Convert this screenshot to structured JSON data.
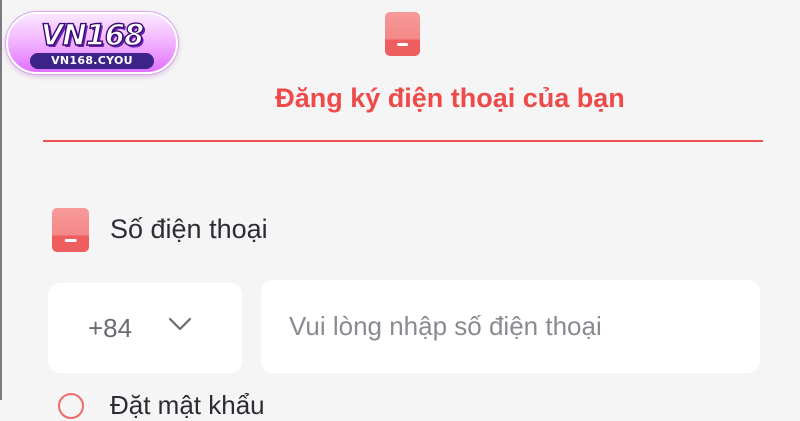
{
  "logo": {
    "brand": "VN168",
    "url": "VN168.CYOU"
  },
  "header": {
    "icon": "mobile-phone-icon",
    "title": "Đăng ký điện thoại của bạn"
  },
  "phone_field": {
    "icon": "mobile-phone-icon",
    "label": "Số điện thoại",
    "country_code": "+84",
    "country_code_icon": "chevron-down-icon",
    "input_value": "",
    "input_placeholder": "Vui lòng nhập số điện thoại"
  },
  "next_field": {
    "icon": "circle-icon",
    "label": "Đặt mật khẩu"
  },
  "colors": {
    "accent": "#ee4a4a",
    "page_background": "#f5f5f6",
    "field_background": "#ffffff",
    "text": "#2c2c34",
    "placeholder": "#8a8a92"
  }
}
